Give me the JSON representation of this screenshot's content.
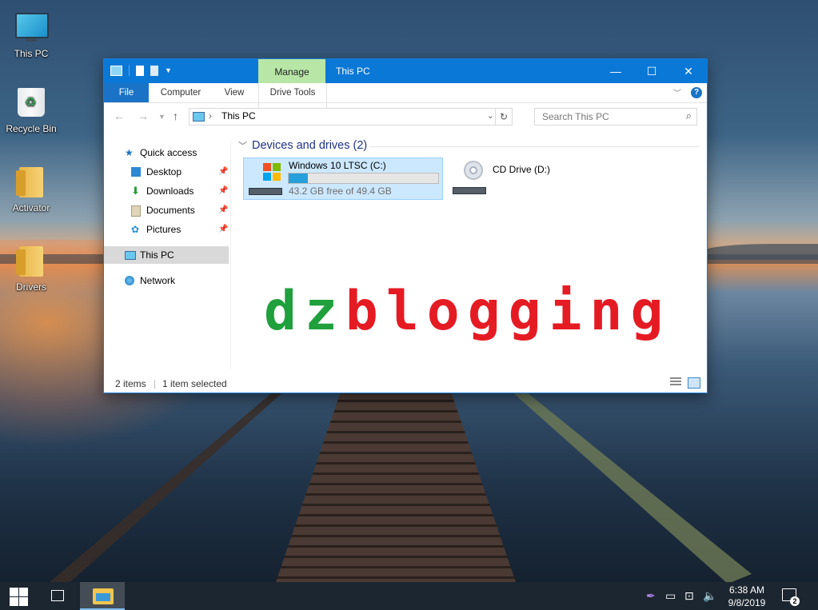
{
  "desktop": {
    "icons": [
      {
        "label": "This PC"
      },
      {
        "label": "Recycle Bin"
      },
      {
        "label": "Activator"
      },
      {
        "label": "Drivers"
      }
    ]
  },
  "window": {
    "title": "This PC",
    "context_tab": "Manage",
    "controls": {
      "minimize": "—",
      "maximize": "☐",
      "close": "✕"
    },
    "ribbon_tabs": [
      "File",
      "Computer",
      "View",
      "Drive Tools"
    ],
    "address": {
      "crumb": "This PC"
    },
    "search": {
      "placeholder": "Search This PC"
    },
    "nav": {
      "quick_access": "Quick access",
      "items": [
        "Desktop",
        "Downloads",
        "Documents",
        "Pictures"
      ],
      "this_pc": "This PC",
      "network": "Network"
    },
    "content": {
      "group_header": "Devices and drives (2)",
      "drives": [
        {
          "name": "Windows 10 LTSC (C:)",
          "free_text": "43.2 GB free of 49.4 GB",
          "used_fraction": 0.13,
          "selected": true
        },
        {
          "name": "CD Drive (D:)",
          "selected": false
        }
      ]
    },
    "status": {
      "items": "2 items",
      "selected": "1 item selected"
    }
  },
  "watermark": {
    "part1": "dz",
    "part2": "blogging",
    "color1": "#1fa03c",
    "color2": "#e51b23"
  },
  "taskbar": {
    "time": "6:38 AM",
    "date": "9/8/2019",
    "notification_count": "2"
  },
  "colors": {
    "accent": "#0a78d7",
    "selection": "#cce8ff",
    "progress": "#26a0da"
  }
}
